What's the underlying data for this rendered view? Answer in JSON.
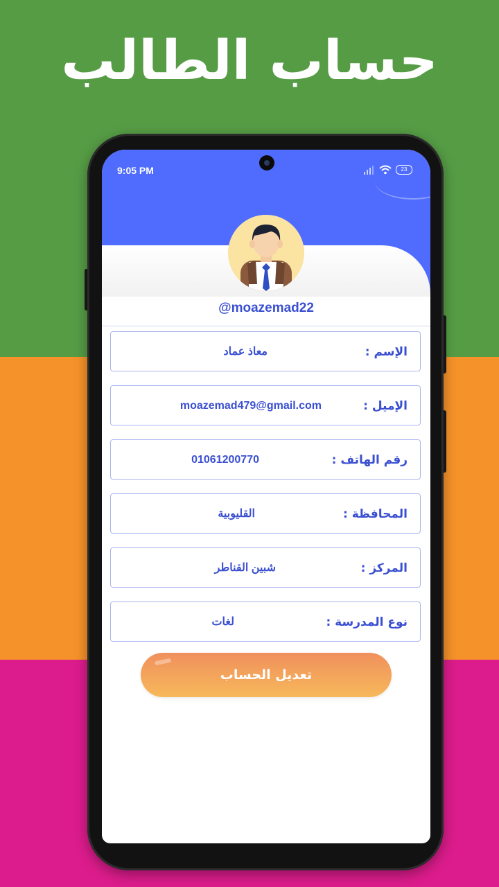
{
  "promo": {
    "title": "حساب الطالب"
  },
  "status_bar": {
    "time": "9:05 PM",
    "battery": "23"
  },
  "profile": {
    "username": "@moazemad22"
  },
  "fields": [
    {
      "label": "الإسم :",
      "value": "معاذ عماد"
    },
    {
      "label": "الإميل :",
      "value": "moazemad479@gmail.com"
    },
    {
      "label": "رقم الهاتف :",
      "value": "01061200770"
    },
    {
      "label": "المحافظة :",
      "value": "القليوبية"
    },
    {
      "label": "المركز :",
      "value": "شبين القناطر"
    },
    {
      "label": "نوع المدرسة :",
      "value": "لغات"
    }
  ],
  "actions": {
    "edit_account": "تعديل الحساب"
  },
  "colors": {
    "primary_blue": "#4f6cff",
    "text_blue": "#3a4fd1",
    "button_orange": "#f0905d",
    "band_green": "#569c45",
    "band_orange": "#f6922a",
    "band_pink": "#dc1c8c"
  }
}
